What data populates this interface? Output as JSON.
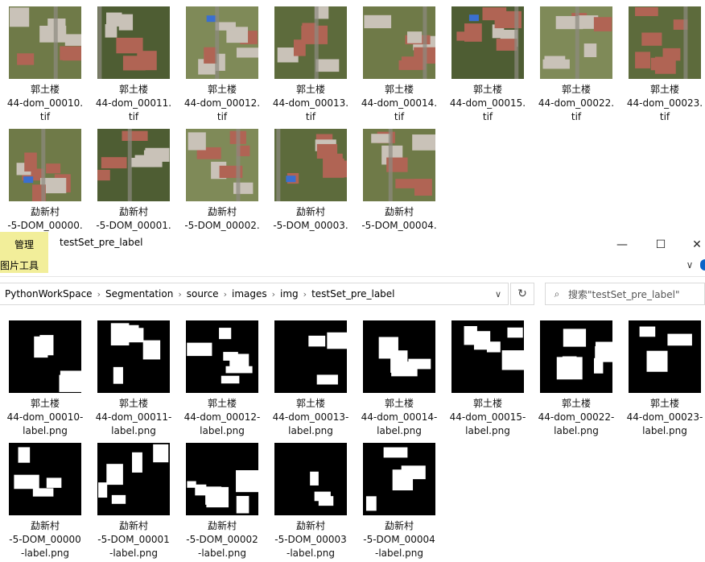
{
  "top_files": [
    {
      "lines": [
        "郭土楼",
        "44-dom_00010.",
        "tif"
      ]
    },
    {
      "lines": [
        "郭土楼",
        "44-dom_00011.",
        "tif"
      ]
    },
    {
      "lines": [
        "郭土楼",
        "44-dom_00012.",
        "tif"
      ]
    },
    {
      "lines": [
        "郭土楼",
        "44-dom_00013.",
        "tif"
      ]
    },
    {
      "lines": [
        "郭土楼",
        "44-dom_00014.",
        "tif"
      ]
    },
    {
      "lines": [
        "郭土楼",
        "44-dom_00015.",
        "tif"
      ]
    },
    {
      "lines": [
        "郭土楼",
        "44-dom_00022.",
        "tif"
      ]
    },
    {
      "lines": [
        "郭土楼",
        "44-dom_00023.",
        "tif"
      ]
    },
    {
      "lines": [
        "勐新村",
        "-5-DOM_00000."
      ]
    },
    {
      "lines": [
        "勐新村",
        "-5-DOM_00001."
      ]
    },
    {
      "lines": [
        "勐新村",
        "-5-DOM_00002."
      ]
    },
    {
      "lines": [
        "勐新村",
        "-5-DOM_00003."
      ]
    },
    {
      "lines": [
        "勐新村",
        "-5-DOM_00004."
      ]
    }
  ],
  "window": {
    "ribbon_contextual_tab": "管理",
    "ribbon_sub_tab": "图片工具",
    "title": "testSet_pre_label",
    "minimize": "—",
    "maximize": "☐",
    "close": "✕",
    "expand_ribbon": "∨"
  },
  "address": {
    "crumbs": [
      "PythonWorkSpace",
      "Segmentation",
      "source",
      "images",
      "img",
      "testSet_pre_label"
    ],
    "dropdown": "∨",
    "refresh": "↻"
  },
  "search": {
    "icon": "search-icon",
    "placeholder": "搜索\"testSet_pre_label\""
  },
  "bottom_files": [
    {
      "lines": [
        "郭土楼",
        "44-dom_00010-",
        "label.png"
      ]
    },
    {
      "lines": [
        "郭土楼",
        "44-dom_00011-",
        "label.png"
      ]
    },
    {
      "lines": [
        "郭土楼",
        "44-dom_00012-",
        "label.png"
      ]
    },
    {
      "lines": [
        "郭土楼",
        "44-dom_00013-",
        "label.png"
      ]
    },
    {
      "lines": [
        "郭土楼",
        "44-dom_00014-",
        "label.png"
      ]
    },
    {
      "lines": [
        "郭土楼",
        "44-dom_00015-",
        "label.png"
      ]
    },
    {
      "lines": [
        "郭土楼",
        "44-dom_00022-",
        "label.png"
      ]
    },
    {
      "lines": [
        "郭土楼",
        "44-dom_00023-",
        "label.png"
      ]
    },
    {
      "lines": [
        "勐新村",
        "-5-DOM_00000",
        "-label.png"
      ]
    },
    {
      "lines": [
        "勐新村",
        "-5-DOM_00001",
        "-label.png"
      ]
    },
    {
      "lines": [
        "勐新村",
        "-5-DOM_00002",
        "-label.png"
      ]
    },
    {
      "lines": [
        "勐新村",
        "-5-DOM_00003",
        "-label.png"
      ]
    },
    {
      "lines": [
        "勐新村",
        "-5-DOM_00004",
        "-label.png"
      ]
    }
  ],
  "colors": {
    "ribbon_tab": "#f2ee9a",
    "accent": "#0a64c8"
  }
}
